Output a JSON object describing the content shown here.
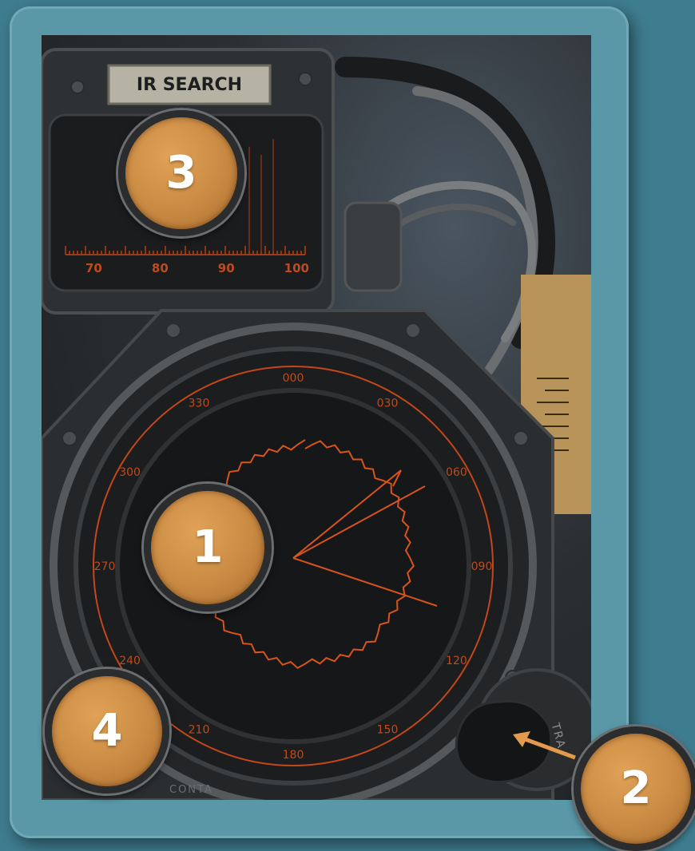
{
  "panel": {
    "plate_label": "IR SEARCH",
    "scale_labels": [
      "70",
      "80",
      "90",
      "100"
    ],
    "dial_labels": [
      "000",
      "030",
      "060",
      "090",
      "120",
      "150",
      "180",
      "210",
      "240",
      "270",
      "300",
      "330"
    ],
    "knob_label": "TRA",
    "bottom_label": "CONTA"
  },
  "markers": [
    {
      "number": "1"
    },
    {
      "number": "2"
    },
    {
      "number": "3"
    },
    {
      "number": "4"
    }
  ],
  "colors": {
    "background": "#3e7c8f",
    "frame": "#5a98a8",
    "marker_fill": "#c98a43",
    "scope_orange": "#d9541c"
  }
}
